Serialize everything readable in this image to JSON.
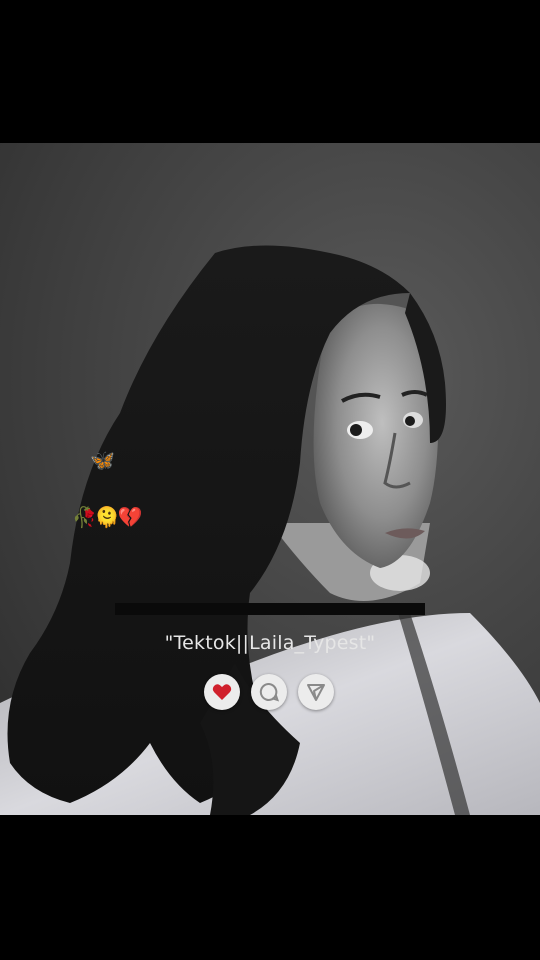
{
  "colors": {
    "background": "#000000",
    "like_heart": "#d0202c",
    "button_fill": "#ececec",
    "icon_stroke": "#8a8a8a",
    "caption_text": "#e6e6e6"
  },
  "overlay": {
    "emoji_butterfly": "🦋",
    "emoji_row": "🥀🫠💔"
  },
  "caption": {
    "text": "\"Tektok||Laila_Typest\""
  },
  "actions": [
    {
      "name": "like",
      "icon": "heart-icon"
    },
    {
      "name": "comment",
      "icon": "comment-icon"
    },
    {
      "name": "share",
      "icon": "send-icon"
    }
  ]
}
